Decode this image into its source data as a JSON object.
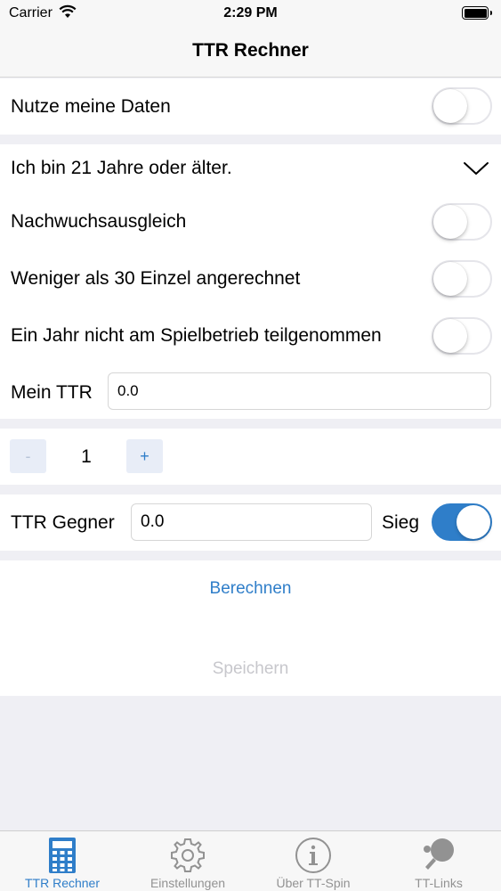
{
  "status_bar": {
    "carrier": "Carrier",
    "time": "2:29 PM"
  },
  "nav": {
    "title": "TTR Rechner"
  },
  "settings": {
    "use_my_data": {
      "label": "Nutze meine Daten",
      "on": false
    },
    "age_select": {
      "label": "Ich bin 21 Jahre oder älter."
    },
    "youth_compensation": {
      "label": "Nachwuchsausgleich",
      "on": false
    },
    "fewer_than_30": {
      "label": "Weniger als 30 Einzel angerechnet",
      "on": false
    },
    "one_year_inactive": {
      "label": "Ein Jahr nicht am Spielbetrieb teilgenommen",
      "on": false
    },
    "my_ttr": {
      "label": "Mein TTR",
      "value": "0.0"
    }
  },
  "stepper": {
    "minus": "-",
    "value": "1",
    "plus": "+"
  },
  "opponent": {
    "label": "TTR Gegner",
    "value": "0.0",
    "win_label": "Sieg",
    "win_on": true
  },
  "actions": {
    "calculate": "Berechnen",
    "save": "Speichern"
  },
  "tabs": [
    {
      "label": "TTR Rechner",
      "icon": "calculator-icon",
      "active": true
    },
    {
      "label": "Einstellungen",
      "icon": "gear-icon",
      "active": false
    },
    {
      "label": "Über TT-Spin",
      "icon": "info-icon",
      "active": false
    },
    {
      "label": "TT-Links",
      "icon": "ping-pong-paddle-icon",
      "active": false
    }
  ],
  "colors": {
    "accent": "#2f7ec9",
    "background": "#efeff4",
    "disabled_text": "#c7c7cc",
    "inactive_tab": "#929292"
  }
}
